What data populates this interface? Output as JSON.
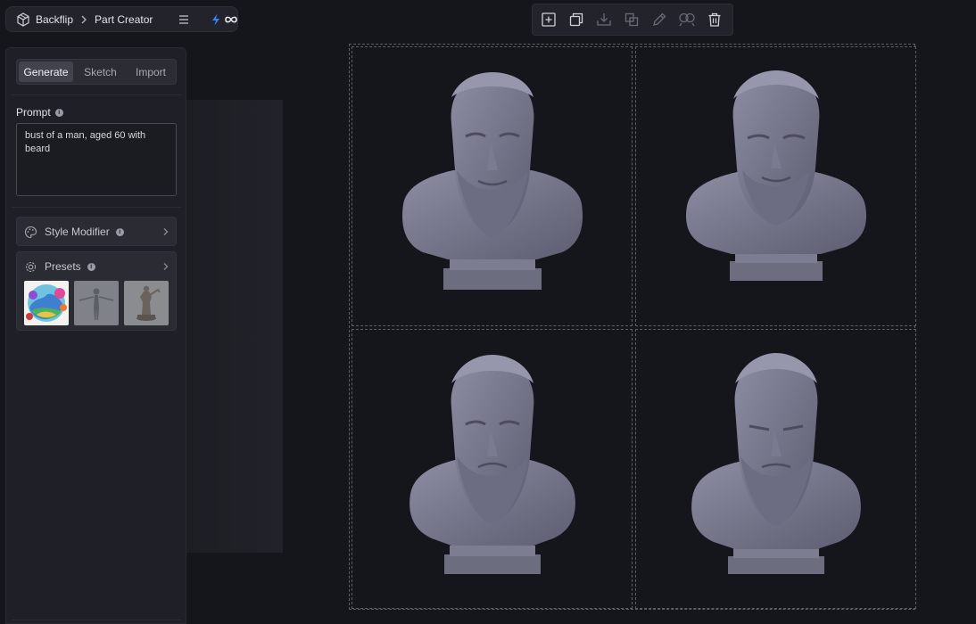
{
  "breadcrumb": {
    "app_name": "Backflip",
    "page_name": "Part Creator",
    "icons": [
      "cube-logo-icon",
      "chevron-right-icon",
      "menu-icon",
      "bolt-icon",
      "infinity-icon"
    ]
  },
  "toolbar": {
    "buttons": [
      "add-frame-icon",
      "duplicate-icon",
      "download-icon",
      "merge-icon",
      "edit-icon",
      "compare-icon",
      "trash-icon"
    ]
  },
  "panel": {
    "tabs": [
      {
        "label": "Generate",
        "active": true
      },
      {
        "label": "Sketch",
        "active": false
      },
      {
        "label": "Import",
        "active": false
      }
    ],
    "prompt_label": "Prompt",
    "prompt_value": "bust of a man, aged 60 with beard",
    "style_modifier_label": "Style Modifier",
    "presets_label": "Presets",
    "preset_thumbnails": [
      "colorful-landscape",
      "humanoid-figure",
      "armored-figurine"
    ]
  },
  "viewport": {
    "results": [
      {
        "name": "bust-result-1"
      },
      {
        "name": "bust-result-2"
      },
      {
        "name": "bust-result-3"
      },
      {
        "name": "bust-result-4"
      }
    ]
  },
  "colors": {
    "background": "#15151c",
    "panel": "#1f1f27",
    "model_gray": "#7b7b90",
    "accent_bolt": "#3b82f6"
  }
}
